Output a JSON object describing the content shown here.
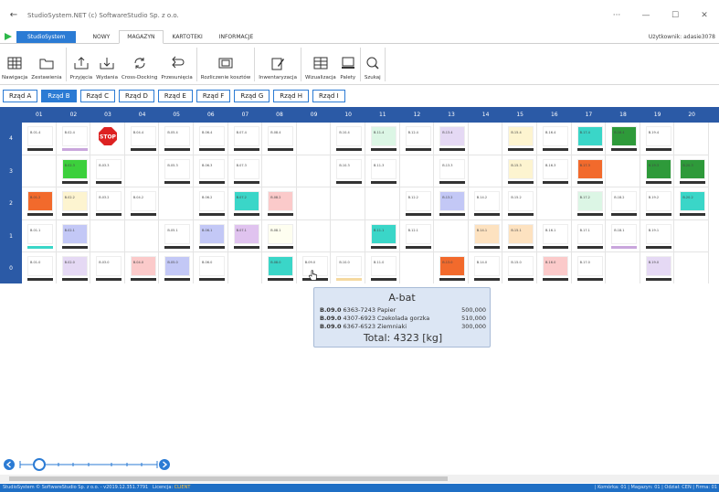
{
  "window": {
    "title": "StudioSystem.NET (c) SoftwareStudio Sp. z o.o."
  },
  "ribbon": {
    "app_tab": "StudioSystem",
    "tabs": [
      "NOWY",
      "MAGAZYN",
      "KARTOTEKI",
      "INFORMACJE"
    ],
    "active_tab": "MAGAZYN",
    "user": "Użytkownik: adasie3078"
  },
  "toolbar": [
    {
      "label": "Nawigacja",
      "icon": "grid-icon"
    },
    {
      "label": "Zestawienia",
      "icon": "folder-icon"
    },
    {
      "label": "Przyjęcia",
      "icon": "inbox-up-icon"
    },
    {
      "label": "Wydania",
      "icon": "inbox-down-icon"
    },
    {
      "label": "Cross-Docking",
      "icon": "cycle-icon"
    },
    {
      "label": "Przesunięcia",
      "icon": "return-icon"
    },
    {
      "label": "Rozliczenie kosztów",
      "icon": "money-icon"
    },
    {
      "label": "Inwentaryzacja",
      "icon": "clipboard-pen-icon"
    },
    {
      "label": "Wizualizacja",
      "icon": "shelves-icon"
    },
    {
      "label": "Palety",
      "icon": "pallet-icon"
    },
    {
      "label": "Szukaj",
      "icon": "search-icon"
    }
  ],
  "rows_nav": {
    "items": [
      "Rząd A",
      "Rząd B",
      "Rząd C",
      "Rząd D",
      "Rząd E",
      "Rząd F",
      "Rząd G",
      "Rząd H",
      "Rząd I"
    ],
    "active": "Rząd B"
  },
  "grid": {
    "columns": [
      "01",
      "02",
      "03",
      "04",
      "05",
      "06",
      "07",
      "08",
      "09",
      "10",
      "11",
      "12",
      "13",
      "14",
      "15",
      "16",
      "17",
      "18",
      "19",
      "20"
    ],
    "rows": [
      {
        "label": "4",
        "cells": [
          {
            "code": "B.01.4",
            "color": "#ffffff",
            "bar": "#333333"
          },
          {
            "code": "B.02.4",
            "color": "#ffffff",
            "bar": "#c9a6dc"
          },
          {
            "code": "STOP",
            "color": "stop",
            "bar": ""
          },
          {
            "code": "B.04.4",
            "color": "#ffffff",
            "bar": "#333333"
          },
          {
            "code": "B.05.4",
            "color": "#ffffff",
            "bar": "#333333"
          },
          {
            "code": "B.06.4",
            "color": "#ffffff",
            "bar": "#333333"
          },
          {
            "code": "B.07.4",
            "color": "#ffffff",
            "bar": "#333333"
          },
          {
            "code": "B.08.4",
            "color": "#ffffff",
            "bar": "#333333"
          },
          {
            "code": "",
            "color": "",
            "bar": ""
          },
          {
            "code": "B.10.4",
            "color": "#ffffff",
            "bar": "#333333"
          },
          {
            "code": "B.11.4",
            "color": "#dcf6e5",
            "bar": "#333333"
          },
          {
            "code": "B.12.4",
            "color": "#ffffff",
            "bar": "#333333"
          },
          {
            "code": "B.13.4",
            "color": "#e5d9f4",
            "bar": "#333333"
          },
          {
            "code": "",
            "color": "",
            "bar": ""
          },
          {
            "code": "B.15.4",
            "color": "#fdf4d0",
            "bar": "#333333"
          },
          {
            "code": "B.16.4",
            "color": "#ffffff",
            "bar": "#333333"
          },
          {
            "code": "B.17.4",
            "color": "#3ad6c8",
            "bar": "#333333"
          },
          {
            "code": "B.18.4",
            "color": "#2e9a3a",
            "bar": "#333333"
          },
          {
            "code": "B.19.4",
            "color": "#ffffff",
            "bar": "#333333"
          },
          {
            "code": "",
            "color": "",
            "bar": ""
          }
        ]
      },
      {
        "label": "3",
        "cells": [
          {
            "code": "",
            "color": "",
            "bar": ""
          },
          {
            "code": "B.02.3",
            "color": "#3cd03c",
            "bar": "#333333"
          },
          {
            "code": "B.03.3",
            "color": "#ffffff",
            "bar": "#333333"
          },
          {
            "code": "",
            "color": "",
            "bar": ""
          },
          {
            "code": "B.05.3",
            "color": "#ffffff",
            "bar": "#333333"
          },
          {
            "code": "B.06.3",
            "color": "#ffffff",
            "bar": "#333333"
          },
          {
            "code": "B.07.3",
            "color": "#ffffff",
            "bar": "#333333"
          },
          {
            "code": "",
            "color": "",
            "bar": ""
          },
          {
            "code": "",
            "color": "",
            "bar": ""
          },
          {
            "code": "B.10.3",
            "color": "#ffffff",
            "bar": "#333333"
          },
          {
            "code": "B.11.3",
            "color": "#ffffff",
            "bar": "#333333"
          },
          {
            "code": "",
            "color": "",
            "bar": ""
          },
          {
            "code": "B.13.3",
            "color": "#ffffff",
            "bar": "#333333"
          },
          {
            "code": "",
            "color": "",
            "bar": ""
          },
          {
            "code": "B.15.3",
            "color": "#fdf4d0",
            "bar": "#333333"
          },
          {
            "code": "B.16.3",
            "color": "#ffffff",
            "bar": "#333333"
          },
          {
            "code": "B.17.3",
            "color": "#f26a2c",
            "bar": "#333333"
          },
          {
            "code": "",
            "color": "",
            "bar": ""
          },
          {
            "code": "B.19.3",
            "color": "#2e9a3a",
            "bar": "#333333"
          },
          {
            "code": "B.20.3",
            "color": "#2e9a3a",
            "bar": "#333333"
          }
        ]
      },
      {
        "label": "2",
        "cells": [
          {
            "code": "B.01.2",
            "color": "#f26a2c",
            "bar": "#333333"
          },
          {
            "code": "B.02.2",
            "color": "#fdf4d0",
            "bar": "#333333"
          },
          {
            "code": "B.03.2",
            "color": "#ffffff",
            "bar": "#333333"
          },
          {
            "code": "B.04.2",
            "color": "#ffffff",
            "bar": "#333333"
          },
          {
            "code": "",
            "color": "",
            "bar": ""
          },
          {
            "code": "B.06.2",
            "color": "#ffffff",
            "bar": "#333333"
          },
          {
            "code": "B.07.2",
            "color": "#3ad6c8",
            "bar": "#333333"
          },
          {
            "code": "B.08.2",
            "color": "#fbcaca",
            "bar": "#333333"
          },
          {
            "code": "",
            "color": "",
            "bar": ""
          },
          {
            "code": "",
            "color": "",
            "bar": ""
          },
          {
            "code": "",
            "color": "",
            "bar": ""
          },
          {
            "code": "B.12.2",
            "color": "#ffffff",
            "bar": "#333333"
          },
          {
            "code": "B.13.2",
            "color": "#c3c8f6",
            "bar": "#333333"
          },
          {
            "code": "B.14.2",
            "color": "#ffffff",
            "bar": "#333333"
          },
          {
            "code": "B.15.2",
            "color": "#ffffff",
            "bar": "#333333"
          },
          {
            "code": "",
            "color": "",
            "bar": ""
          },
          {
            "code": "B.17.2",
            "color": "#dcf6e5",
            "bar": "#333333"
          },
          {
            "code": "B.18.2",
            "color": "#ffffff",
            "bar": "#333333"
          },
          {
            "code": "B.19.2",
            "color": "#ffffff",
            "bar": "#333333"
          },
          {
            "code": "B.20.2",
            "color": "#3ad6c8",
            "bar": "#333333"
          }
        ]
      },
      {
        "label": "1",
        "cells": [
          {
            "code": "B.01.1",
            "color": "#ffffff",
            "bar": "#3ad6c8"
          },
          {
            "code": "B.02.1",
            "color": "#c3c8f6",
            "bar": "#333333"
          },
          {
            "code": "",
            "color": "",
            "bar": ""
          },
          {
            "code": "",
            "color": "",
            "bar": ""
          },
          {
            "code": "B.05.1",
            "color": "#ffffff",
            "bar": "#333333"
          },
          {
            "code": "B.06.1",
            "color": "#c3c8f6",
            "bar": "#333333"
          },
          {
            "code": "B.07.1",
            "color": "#e0c3ef",
            "bar": "#333333"
          },
          {
            "code": "B.08.1",
            "color": "#fefef0",
            "bar": "#333333"
          },
          {
            "code": "",
            "color": "",
            "bar": ""
          },
          {
            "code": "",
            "color": "",
            "bar": ""
          },
          {
            "code": "B.11.1",
            "color": "#3ad6c8",
            "bar": "#333333"
          },
          {
            "code": "B.12.1",
            "color": "#ffffff",
            "bar": "#333333"
          },
          {
            "code": "",
            "color": "",
            "bar": ""
          },
          {
            "code": "B.14.1",
            "color": "#fde2c0",
            "bar": "#333333"
          },
          {
            "code": "B.15.1",
            "color": "#fde2c0",
            "bar": "#333333"
          },
          {
            "code": "B.16.1",
            "color": "#ffffff",
            "bar": "#333333"
          },
          {
            "code": "B.17.1",
            "color": "#ffffff",
            "bar": "#333333"
          },
          {
            "code": "B.18.1",
            "color": "#ffffff",
            "bar": "#c9a6dc"
          },
          {
            "code": "B.19.1",
            "color": "#ffffff",
            "bar": "#333333"
          },
          {
            "code": "",
            "color": "",
            "bar": ""
          }
        ]
      },
      {
        "label": "0",
        "cells": [
          {
            "code": "B.01.0",
            "color": "#ffffff",
            "bar": "#333333"
          },
          {
            "code": "B.02.0",
            "color": "#e5d9f4",
            "bar": "#333333"
          },
          {
            "code": "B.03.0",
            "color": "#ffffff",
            "bar": "#333333"
          },
          {
            "code": "B.04.0",
            "color": "#fbcaca",
            "bar": "#333333"
          },
          {
            "code": "B.05.0",
            "color": "#c3c8f6",
            "bar": "#333333"
          },
          {
            "code": "B.06.0",
            "color": "#ffffff",
            "bar": "#333333"
          },
          {
            "code": "",
            "color": "",
            "bar": ""
          },
          {
            "code": "B.08.0",
            "color": "#3ad6c8",
            "bar": "#333333"
          },
          {
            "code": "B.09.0",
            "color": "#ffffff",
            "bar": "#333333"
          },
          {
            "code": "B.10.0",
            "color": "#ffffff",
            "bar": "#f5d9a0"
          },
          {
            "code": "B.11.0",
            "color": "#ffffff",
            "bar": "#333333"
          },
          {
            "code": "",
            "color": "",
            "bar": ""
          },
          {
            "code": "B.13.0",
            "color": "#f26a2c",
            "bar": "#333333"
          },
          {
            "code": "B.14.0",
            "color": "#ffffff",
            "bar": "#333333"
          },
          {
            "code": "B.15.0",
            "color": "#ffffff",
            "bar": "#333333"
          },
          {
            "code": "B.16.0",
            "color": "#fbcaca",
            "bar": "#333333"
          },
          {
            "code": "B.17.0",
            "color": "#ffffff",
            "bar": "#333333"
          },
          {
            "code": "",
            "color": "",
            "bar": ""
          },
          {
            "code": "B.19.0",
            "color": "#e5d9f4",
            "bar": "#333333"
          },
          {
            "code": "",
            "color": "",
            "bar": ""
          }
        ]
      }
    ]
  },
  "tooltip": {
    "title": "A-bat",
    "lines": [
      {
        "loc": "B.09.0",
        "desc": "6363-7243 Papier",
        "qty": "500,000"
      },
      {
        "loc": "B.09.0",
        "desc": "4307-6923 Czekolada gorzka",
        "qty": "510,000"
      },
      {
        "loc": "B.09.0",
        "desc": "6367-6523 Ziemniaki",
        "qty": "300,000"
      }
    ],
    "total": "Total: 4323 [kg]"
  },
  "status": {
    "left": "StudioSystem © SoftwareStudio Sp. z o.o. - v2019.12.351.7791",
    "license_label": "Licencja:",
    "license_value": "CLIENT",
    "right": "| Komórka: 01 | Magazyn: 01 | Odział: CEN | Firma: 01"
  },
  "zoom": {
    "level": 0.14
  }
}
